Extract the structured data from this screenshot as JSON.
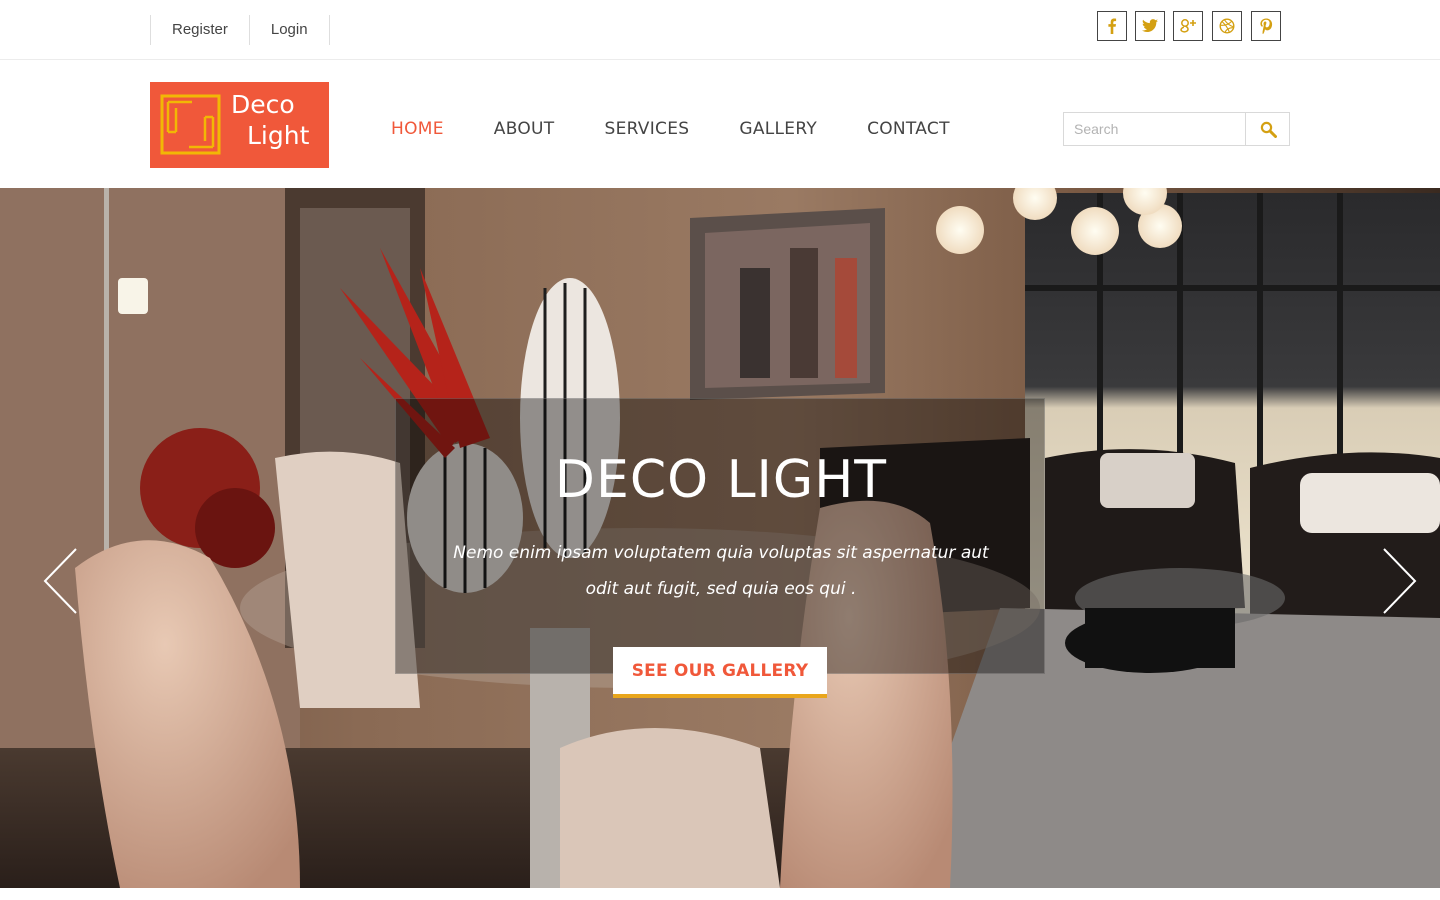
{
  "topbar": {
    "links": [
      "Register",
      "Login"
    ],
    "social": [
      {
        "icon": "facebook-icon",
        "glyph": "f"
      },
      {
        "icon": "twitter-icon",
        "glyph": "t"
      },
      {
        "icon": "google-plus-icon",
        "glyph": "g+"
      },
      {
        "icon": "dribbble-icon",
        "glyph": "d"
      },
      {
        "icon": "pinterest-icon",
        "glyph": "p"
      }
    ],
    "social_color": "#d4a012"
  },
  "logo": {
    "line1": "Deco",
    "line2": "Light",
    "bg_color": "#f0583a"
  },
  "nav": {
    "items": [
      "HOME",
      "ABOUT",
      "SERVICES",
      "GALLERY",
      "CONTACT"
    ],
    "active": "HOME",
    "active_color": "#f0583a"
  },
  "search": {
    "placeholder": "Search"
  },
  "hero": {
    "title": "DECO LIGHT",
    "text": "Nemo enim ipsam voluptatem quia voluptas sit aspernatur aut odit aut fugit, sed quia eos qui .",
    "button": "SEE OUR GALLERY",
    "button_underline_color": "#e9a61c",
    "prev_icon": "chevron-left-icon",
    "next_icon": "chevron-right-icon"
  }
}
